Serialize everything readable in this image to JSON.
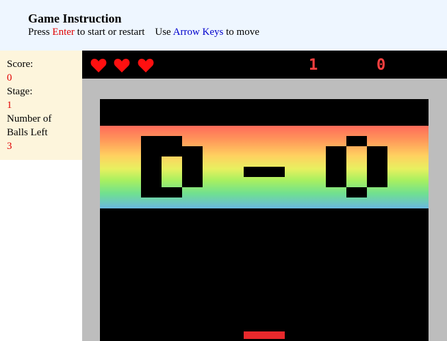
{
  "instructions": {
    "title": "Game Instruction",
    "press": "Press ",
    "enter": "Enter",
    "restart": " to start or restart    Use ",
    "arrows": "Arrow Keys",
    "move": " to move"
  },
  "sidebar": {
    "score_label": "Score:",
    "score_value": "0",
    "stage_label": "Stage:",
    "stage_value": "1",
    "balls_label_1": "Number of",
    "balls_label_2": "Balls Left",
    "balls_value": "3"
  },
  "hud": {
    "lives": 3,
    "stage_digit": "1",
    "score_digit": "0",
    "heart_color": "#ff1010"
  },
  "board": {
    "left_score": "6",
    "separator": "-",
    "right_score": "0"
  },
  "colors": {
    "paddle": "#e8292c",
    "wall": "#bdbdbd",
    "hud_text": "#ff4040"
  }
}
